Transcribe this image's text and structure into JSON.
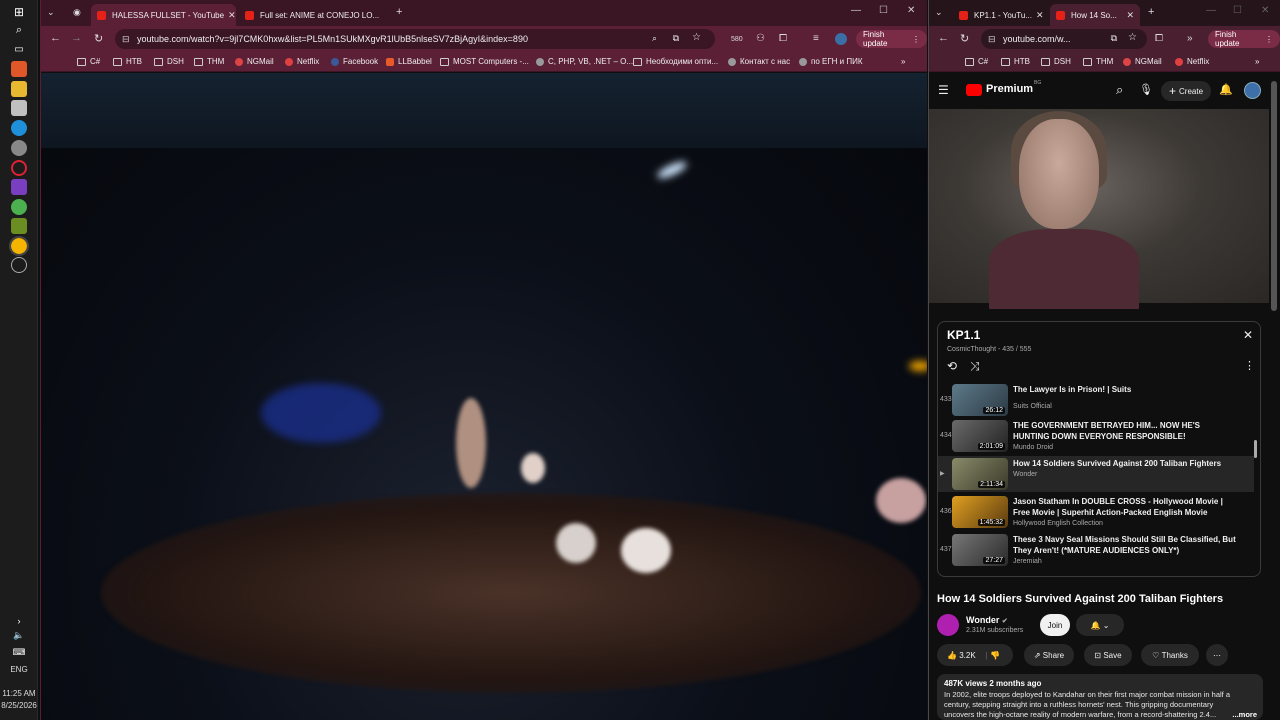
{
  "taskbar": {
    "lang": "ENG",
    "time": "11:25 AM",
    "date": "8/25/2026"
  },
  "left_window": {
    "tabs": [
      {
        "label": "HALESSA FULLSET - YouTube"
      },
      {
        "label": "Full set: ANIME at CONEJO LO..."
      }
    ],
    "url": "youtube.com/watch?v=9jl7CMK0hxw&list=PL5Mn1SUkMXgvR1lUbB5nlseSV7zBjAgyI&index=890",
    "badge": "580",
    "finish_update": "Finish update",
    "bookmarks": [
      "C#",
      "HTB",
      "DSH",
      "THM",
      "NGMail",
      "Netflix",
      "Facebook",
      "LLBabbel",
      "MOST Computers -...",
      "C, PHP, VB, .NET – O...",
      "Необходими опти...",
      "Контакт с нас",
      "по ЕГН и ПИК"
    ],
    "bm_more": "»"
  },
  "right_window": {
    "tabs": [
      {
        "label": "KP1.1 - YouTu..."
      },
      {
        "label": "How 14 So..."
      }
    ],
    "url": "youtube.com/w...",
    "finish_update": "Finish update",
    "bookmarks": [
      "C#",
      "HTB",
      "DSH",
      "THM",
      "NGMail",
      "Netflix"
    ],
    "bm_more": "»"
  },
  "youtube": {
    "logo": "Premium",
    "logo_sup": "BG",
    "create": "Create",
    "playlist": {
      "title": "KP1.1",
      "subtitle": "CosmicThought - 435 / 555",
      "items": [
        {
          "idx": "433",
          "title": "The Lawyer Is in Prison! | Suits",
          "channel": "Suits Official",
          "duration": "26:12"
        },
        {
          "idx": "434",
          "title": "THE GOVERNMENT BETRAYED HIM... NOW HE'S HUNTING DOWN EVERYONE RESPONSIBLE!",
          "channel": "Mundo Droid",
          "duration": "2:01:09"
        },
        {
          "idx": "▶",
          "title": "How 14 Soldiers Survived Against 200 Taliban Fighters",
          "channel": "Wonder",
          "duration": "2:11:34"
        },
        {
          "idx": "436",
          "title": "Jason Statham In DOUBLE CROSS - Hollywood Movie | Free Movie | Superhit Action-Packed English Movie",
          "channel": "Hollywood English Collection",
          "duration": "1:45:32"
        },
        {
          "idx": "437",
          "title": "These 3 Navy Seal Missions Should Still Be Classified, But They Aren't! (*MATURE AUDIENCES ONLY*)",
          "channel": "Jeremiah",
          "duration": "27:27"
        }
      ]
    },
    "video": {
      "title": "How 14 Soldiers Survived Against 200 Taliban Fighters",
      "channel": "Wonder",
      "subscribers": "2.31M subscribers",
      "join": "Join",
      "likes": "3.2K",
      "share": "Share",
      "save": "Save",
      "thanks": "Thanks",
      "views": "487K views  2 months ago",
      "description": "In 2002, elite troops deployed to Kandahar on their first major combat mission in half a century, stepping straight into a ruthless hornets' nest. This gripping documentary uncovers the high-octane reality of modern warfare, from a record-shattering 2.4...",
      "more": "...more"
    }
  },
  "colors": {
    "accent": "#5b1f36",
    "youtube_red": "#ff0000"
  }
}
